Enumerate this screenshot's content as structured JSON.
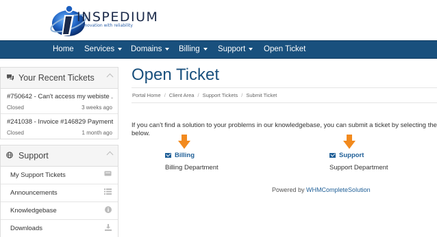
{
  "brand": {
    "name": "INSPEDIUM",
    "tagline": "innovation with reliability"
  },
  "nav": {
    "items": [
      {
        "label": "Home"
      },
      {
        "label": "Services"
      },
      {
        "label": "Domains"
      },
      {
        "label": "Billing"
      },
      {
        "label": "Support"
      },
      {
        "label": "Open Ticket"
      }
    ]
  },
  "recent_tickets": {
    "title": "Your Recent Tickets",
    "tickets": [
      {
        "subject": "#750642 - Can't access my webiste ...",
        "status": "Closed",
        "time": "3 weeks ago"
      },
      {
        "subject": "#241038 - Invoice #146829 Payment",
        "status": "Closed",
        "time": "1 month ago"
      }
    ]
  },
  "support_panel": {
    "title": "Support",
    "items": [
      {
        "label": "My Support Tickets",
        "icon": "ticket-icon"
      },
      {
        "label": "Announcements",
        "icon": "list-icon"
      },
      {
        "label": "Knowledgebase",
        "icon": "info-icon"
      },
      {
        "label": "Downloads",
        "icon": "download-icon"
      }
    ]
  },
  "main": {
    "title": "Open Ticket",
    "breadcrumb": [
      "Portal Home",
      "Client Area",
      "Support Tickets",
      "Submit Ticket"
    ],
    "intro_line1": "If you can't find a solution to your problems in our knowledgebase, you can submit a ticket by selecting the",
    "intro_line2": "below.",
    "departments": [
      {
        "name": "Billing",
        "description": "Billing Department"
      },
      {
        "name": "Support",
        "description": "Support Department"
      }
    ],
    "powered_prefix": "Powered by",
    "powered_link": "WHMCompleteSolution"
  },
  "colors": {
    "navbar": "#19507d",
    "link": "#1f5f97",
    "arrow": "#f28a1e"
  }
}
